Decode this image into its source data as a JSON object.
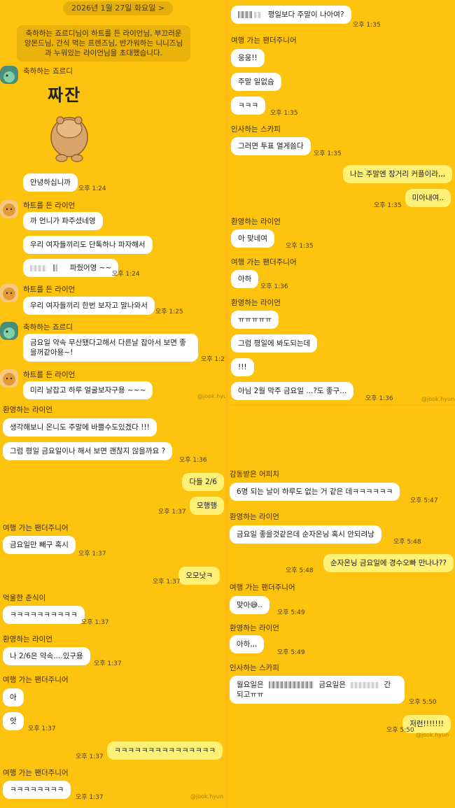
{
  "left": {
    "date_label": "2026년 1월 27일 화요일 >",
    "system_notice": "축하하는 죠르디님이 하트를 든 라이언님, 부끄러운 앙몬드님, 간식 먹는 프렌즈님, 반가워하는 니니즈님과 누워있는 라이언님을 초대했습니다.",
    "sticker_text": "짜잔",
    "names": {
      "jordy": "축하하는 죠르디",
      "ryan_heart": "하트를 든 라이언",
      "ryan_welcome": "환영하는 라이언",
      "panda": "여행 가는 팬더주니어",
      "chunsik": "억울한 춘식이"
    },
    "messages": {
      "m1": "안녕하십니까",
      "m2": "까 언니가 파주셨네영",
      "m3": "우리 여자들끼리도 단톡하나 파자해서",
      "m4": "파줬어영 ~~",
      "m5": "우리 여자들끼리 한번 보자고 말나와서",
      "m6": "금요일 약속 무산됐다고해서 다른날 잡아서 보면 좋을꺼같아용~!",
      "m7": "미리 날잡고 하루 얼굴보자구용 ~~~",
      "m8": "생각해보니 온니도 주말에 바쁠수도있겠다 !!!",
      "m9": "그럼 평일 금요일이나 해서 보면 괜찮지 않을까요 ?",
      "m10": "다들 2/6",
      "m11": "모행행",
      "m12": "금요일만 빼구 혹시",
      "m13": "오모낫ㅋ",
      "m14": "ㅋㅋㅋㅋㅋㅋㅋㅋㅋㅋ",
      "m15": "나 2/6은 약속....있구용",
      "m16": "아",
      "m17": "앗",
      "m18": "ㅋㅋㅋㅋㅋㅋㅋㅋㅋㅋㅋㅋㅋㅋㅋ",
      "m19": "ㅋㅋㅋㅋㅋㅋㅋㅋ"
    },
    "times": {
      "t124": "오후 1:24",
      "t125": "오후 1:25",
      "t136": "오후 1:36",
      "t137": "오후 1:37"
    },
    "watermark": "@jook.hyun"
  },
  "right_top": {
    "names": {
      "panda": "여행 가는 팬더주니어",
      "skappy": "인사하는 스카피",
      "ryan_welcome": "환영하는 라이언"
    },
    "messages": {
      "r1": "평일보다 주말이 나아여?",
      "r2": "웅웅!!",
      "r3": "주말 일없슴",
      "r4": "ㅋㅋㅋ",
      "r5": "그러면 투표 열게씀다",
      "r6": "나는 주말엔 장거리 커플이라,,,",
      "r7": "미아내여..",
      "r8": "아 맞네여",
      "r9": "아하",
      "r10": "ㅠㅠㅠㅠㅠ",
      "r11": "그럼 평일에 봐도되는데",
      "r12": "!!!",
      "r13": "아님 2월 막주 금요일 ...?도 좋구..."
    },
    "times": {
      "t135": "오후 1:35",
      "t136": "오후 1:36"
    },
    "watermark": "@jook.hyun"
  },
  "right_bottom": {
    "names": {
      "apeach": "감동받은 어피치",
      "ryan_welcome": "환영하는 라이언",
      "panda": "여행 가는 팬더주니어",
      "skappy": "인사하는 스카피"
    },
    "messages": {
      "b1": "6명 되는 날이 하루도 없는 거 같은 데ㅋㅋㅋㅋㅋㅋ",
      "b2": "금요일 좋을것같은데 순자온닝 혹시 안되려낭",
      "b3": "순자온닝 금요일에 경수오빠 만나나??",
      "b4": "맞아😅..",
      "b5": "아하,,,",
      "b6a": "월요일은",
      "b6b": "금요일은",
      "b6c": "간",
      "b6d": "되고ㅠㅠ",
      "b7": "저런!!!!!!!"
    },
    "times": {
      "t547": "오후 5:47",
      "t548": "오후 5:48",
      "t549": "오후 5:49",
      "t550": "오후 5:50"
    },
    "watermark": "@jook.hyun"
  }
}
